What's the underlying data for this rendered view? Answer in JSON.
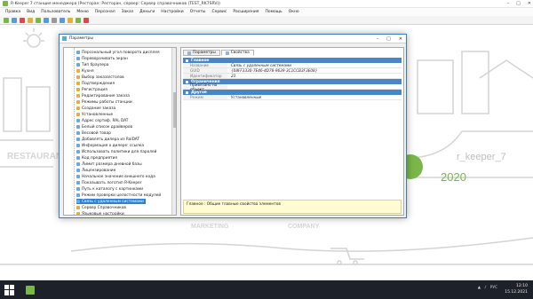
{
  "window": {
    "title": "R-Keeper 7 станция менеджера (Ресторан: Ресторан, сервер: Сервер справочников (TEST_RK7SRV))"
  },
  "menu": [
    "Правка",
    "Вид",
    "Пользователь",
    "Меню",
    "Персонал",
    "Заказ",
    "Деньги",
    "Настройки",
    "Отчеты",
    "Сервис",
    "Расширения",
    "Помощь",
    "Окно"
  ],
  "background": {
    "restaurant_text": "RESTAURANT",
    "brand_text": "r_keeper_7",
    "year_text": "2020",
    "marketing_text": "MARKETING",
    "company_text": "COMPANY"
  },
  "dialog": {
    "title": "Параметры",
    "tree": [
      {
        "label": "Персональный угол поворота дисплея",
        "type": "item"
      },
      {
        "label": "Переворачивать экран",
        "type": "item"
      },
      {
        "label": "Тип браузера",
        "type": "item"
      },
      {
        "label": "Кухня",
        "type": "folder"
      },
      {
        "label": "Выбор заказа/столов",
        "type": "folder"
      },
      {
        "label": "Подтверждения",
        "type": "folder"
      },
      {
        "label": "Регистрация",
        "type": "folder"
      },
      {
        "label": "Редактирование заказа",
        "type": "folder"
      },
      {
        "label": "Режимы работы станции",
        "type": "folder"
      },
      {
        "label": "Создание заказа",
        "type": "folder"
      },
      {
        "label": "Установленные",
        "type": "folder"
      },
      {
        "label": "Адрес сертиф. RAL DAT",
        "type": "item"
      },
      {
        "label": "Белый список драйверов",
        "type": "item"
      },
      {
        "label": "Весовой товар",
        "type": "item"
      },
      {
        "label": "Добавлять дилера из RalDAT",
        "type": "item"
      },
      {
        "label": "Информация о дилере: ссылка",
        "type": "item"
      },
      {
        "label": "Использовать политики для паролей",
        "type": "item"
      },
      {
        "label": "Код предприятия",
        "type": "item"
      },
      {
        "label": "Лимит размера дневной базы",
        "type": "item"
      },
      {
        "label": "Лицензирование",
        "type": "item"
      },
      {
        "label": "Начальное значение внешнего кода",
        "type": "item"
      },
      {
        "label": "Показывать логотип R-Keeper",
        "type": "item"
      },
      {
        "label": "Путь к каталогу с картинками",
        "type": "item"
      },
      {
        "label": "Режим проверки целостности модулей",
        "type": "item"
      },
      {
        "label": "Связь с удаленным системами",
        "type": "item",
        "selected": true
      },
      {
        "label": "Сервер Справочников",
        "type": "folder"
      },
      {
        "label": "Языковые настройки",
        "type": "folder"
      }
    ],
    "tabs": [
      "Параметры",
      "Свойства"
    ],
    "sections": [
      {
        "title": "Главное",
        "rows": [
          {
            "key": "Название",
            "value": "Связь с удаленным системами"
          },
          {
            "key": "GUID",
            "value": "{08FF3330-7E46-4D78-9639-3C1CCB3F3E08}"
          },
          {
            "key": "Идентификатор",
            "value": "23"
          }
        ]
      },
      {
        "title": "Ограничения",
        "rows": [
          {
            "key": "Привязано на объект",
            "value": "",
            "strong": true
          }
        ]
      },
      {
        "title": "Другое",
        "rows": [
          {
            "key": "Режим",
            "value": "Установленные"
          }
        ]
      }
    ],
    "description": "Главное : Общие главные свойства элементов"
  },
  "taskbar": {
    "time": "12:10",
    "date": "15.12.2021",
    "lang": "РУС"
  }
}
